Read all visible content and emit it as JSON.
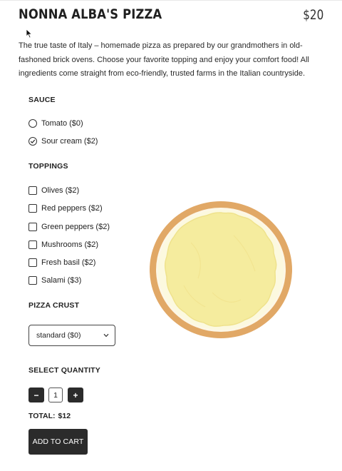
{
  "product": {
    "title": "NONNA ALBA'S PIZZA",
    "price": "$20",
    "description": "The true taste of Italy – homemade pizza as prepared by our grandmothers in old-fashoned brick ovens. Choose your favorite topping and enjoy your comfort food! All ingredients come straight from eco-friendly, trusted farms in the Italian countryside."
  },
  "sauce": {
    "title": "SAUCE",
    "options": [
      {
        "label": "Tomato ($0)",
        "checked": false
      },
      {
        "label": "Sour cream ($2)",
        "checked": true
      }
    ]
  },
  "toppings": {
    "title": "TOPPINGS",
    "options": [
      {
        "label": "Olives ($2)",
        "checked": false
      },
      {
        "label": "Red peppers ($2)",
        "checked": false
      },
      {
        "label": "Green peppers ($2)",
        "checked": false
      },
      {
        "label": "Mushrooms ($2)",
        "checked": false
      },
      {
        "label": "Fresh basil ($2)",
        "checked": false
      },
      {
        "label": "Salami ($3)",
        "checked": false
      }
    ]
  },
  "crust": {
    "title": "PIZZA CRUST",
    "selected": "standard ($0)"
  },
  "quantity": {
    "title": "SELECT QUANTITY",
    "minus": "−",
    "value": "1",
    "plus": "+"
  },
  "total": {
    "label": "TOTAL:",
    "value": "$12"
  },
  "add_to_cart": "ADD TO CART",
  "colors": {
    "crust": "#e1a866",
    "cheese": "#f5ec9e",
    "base": "#fcf9df",
    "button": "#2b2b2b"
  },
  "icons": {
    "cursor": "arrow-cursor-icon",
    "select_arrow": "chevron-down-icon",
    "selected_radio": "checkmark-icon"
  }
}
